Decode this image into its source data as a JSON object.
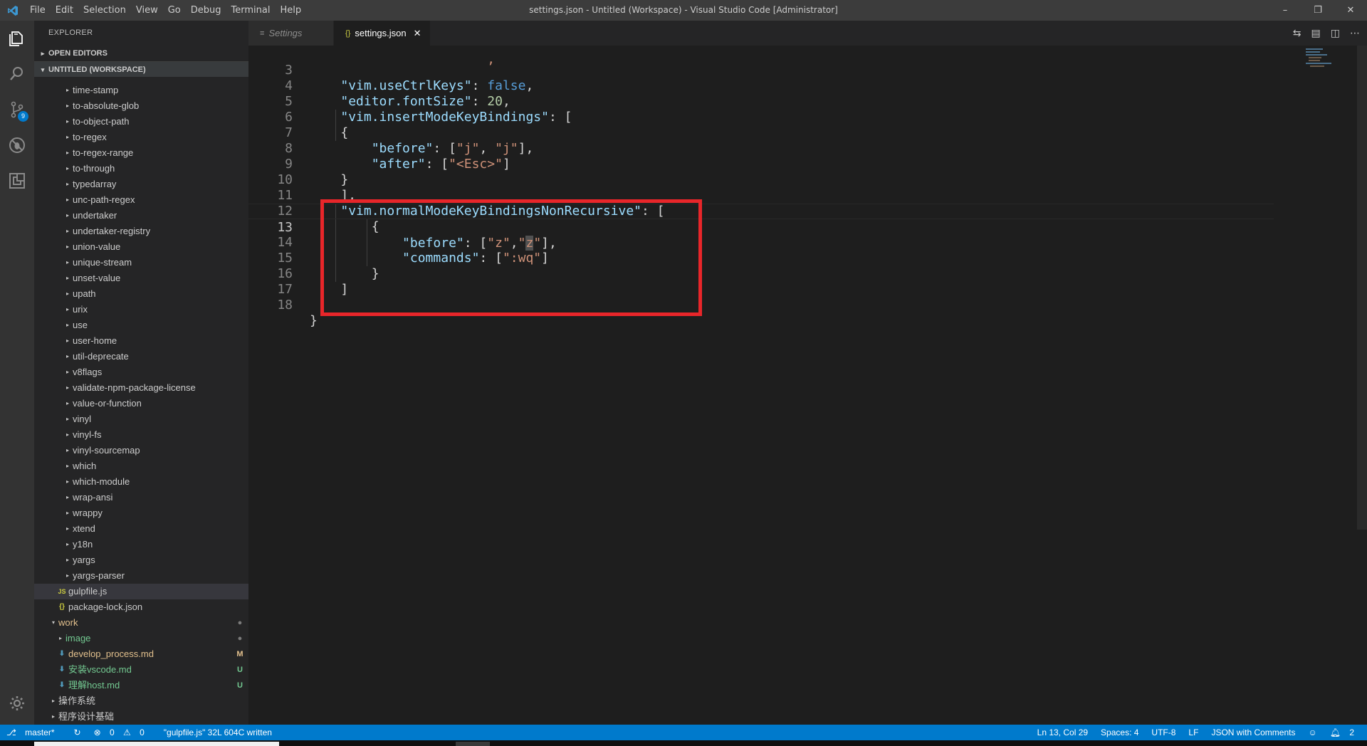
{
  "window": {
    "title": "settings.json - Untitled (Workspace) - Visual Studio Code [Administrator]",
    "menu": [
      "File",
      "Edit",
      "Selection",
      "View",
      "Go",
      "Debug",
      "Terminal",
      "Help"
    ]
  },
  "activity_bar": {
    "source_control_badge": "9"
  },
  "sidebar": {
    "title": "EXPLORER",
    "open_editors": "OPEN EDITORS",
    "workspace": "UNTITLED (WORKSPACE)",
    "folders": [
      "time-stamp",
      "to-absolute-glob",
      "to-object-path",
      "to-regex",
      "to-regex-range",
      "to-through",
      "typedarray",
      "unc-path-regex",
      "undertaker",
      "undertaker-registry",
      "union-value",
      "unique-stream",
      "unset-value",
      "upath",
      "urix",
      "use",
      "user-home",
      "util-deprecate",
      "v8flags",
      "validate-npm-package-license",
      "value-or-function",
      "vinyl",
      "vinyl-fs",
      "vinyl-sourcemap",
      "which",
      "which-module",
      "wrap-ansi",
      "wrappy",
      "xtend",
      "y18n",
      "yargs",
      "yargs-parser"
    ],
    "files": {
      "gulpfile": "gulpfile.js",
      "package_lock": "package-lock.json",
      "work": "work",
      "image": "image",
      "develop": "develop_process.md",
      "develop_status": "M",
      "vscode": "安装vscode.md",
      "vscode_status": "U",
      "host": "理解host.md",
      "host_status": "U",
      "os": "操作系统",
      "prog": "程序设计基础"
    },
    "icons": {
      "js": "JS",
      "json": "{}"
    }
  },
  "tabs": [
    {
      "label": "Settings",
      "active": false
    },
    {
      "label": "settings.json",
      "active": true
    }
  ],
  "editor": {
    "lines": [
      {
        "n": "3",
        "code": "vim.useCtrlKeys"
      },
      {
        "n": "4"
      },
      {
        "n": "5"
      },
      {
        "n": "6"
      },
      {
        "n": "7"
      },
      {
        "n": "8"
      },
      {
        "n": "9"
      },
      {
        "n": "10"
      },
      {
        "n": "11"
      },
      {
        "n": "12"
      },
      {
        "n": "13"
      },
      {
        "n": "14"
      },
      {
        "n": "15"
      },
      {
        "n": "16"
      },
      {
        "n": "17"
      },
      {
        "n": "18"
      }
    ]
  },
  "statusbar": {
    "branch": "master*",
    "errors": "0",
    "warnings": "0",
    "message": "\"gulpfile.js\" 32L 604C written",
    "position": "Ln 13, Col 29",
    "spaces": "Spaces: 4",
    "encoding": "UTF-8",
    "eol": "LF",
    "language": "JSON with Comments",
    "notifications": "2"
  },
  "colors": {
    "accent": "#007acc",
    "highlight_box": "#e8262a",
    "modified": "#e2c08d",
    "untracked": "#73c991"
  }
}
